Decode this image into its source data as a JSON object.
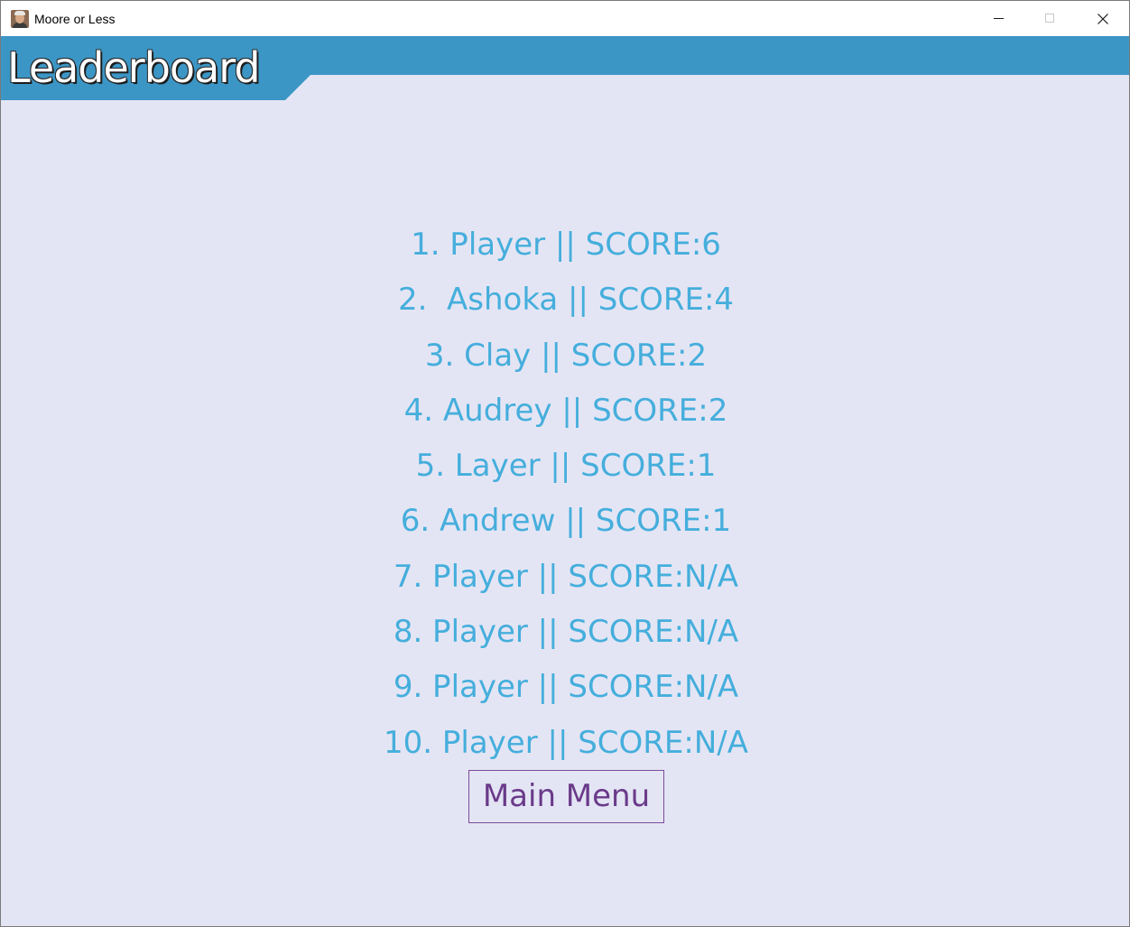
{
  "window": {
    "title": "Moore or Less",
    "app_icon": "app-portrait-icon",
    "controls": {
      "minimize_icon": "minimize-icon",
      "maximize_icon": "maximize-icon",
      "close_icon": "close-icon"
    }
  },
  "header": {
    "title": "Leaderboard",
    "band_color": "#3c96c5"
  },
  "leaderboard": {
    "entries": [
      {
        "text": "1. Player || SCORE:6",
        "rank": 1,
        "name": "Player",
        "score": "6"
      },
      {
        "text": "2.  Ashoka || SCORE:4",
        "rank": 2,
        "name": "Ashoka",
        "score": "4"
      },
      {
        "text": "3. Clay || SCORE:2",
        "rank": 3,
        "name": "Clay",
        "score": "2"
      },
      {
        "text": "4. Audrey || SCORE:2",
        "rank": 4,
        "name": "Audrey",
        "score": "2"
      },
      {
        "text": "5. Layer || SCORE:1",
        "rank": 5,
        "name": "Layer",
        "score": "1"
      },
      {
        "text": "6. Andrew || SCORE:1",
        "rank": 6,
        "name": "Andrew",
        "score": "1"
      },
      {
        "text": "7. Player || SCORE:N/A",
        "rank": 7,
        "name": "Player",
        "score": "N/A"
      },
      {
        "text": "8. Player || SCORE:N/A",
        "rank": 8,
        "name": "Player",
        "score": "N/A"
      },
      {
        "text": "9. Player || SCORE:N/A",
        "rank": 9,
        "name": "Player",
        "score": "N/A"
      },
      {
        "text": "10. Player || SCORE:N/A",
        "rank": 10,
        "name": "Player",
        "score": "N/A"
      }
    ],
    "text_color": "#45aedc"
  },
  "actions": {
    "main_menu_label": "Main Menu",
    "main_menu_color": "#6a3a8a"
  },
  "colors": {
    "background": "#e4e5f4"
  }
}
